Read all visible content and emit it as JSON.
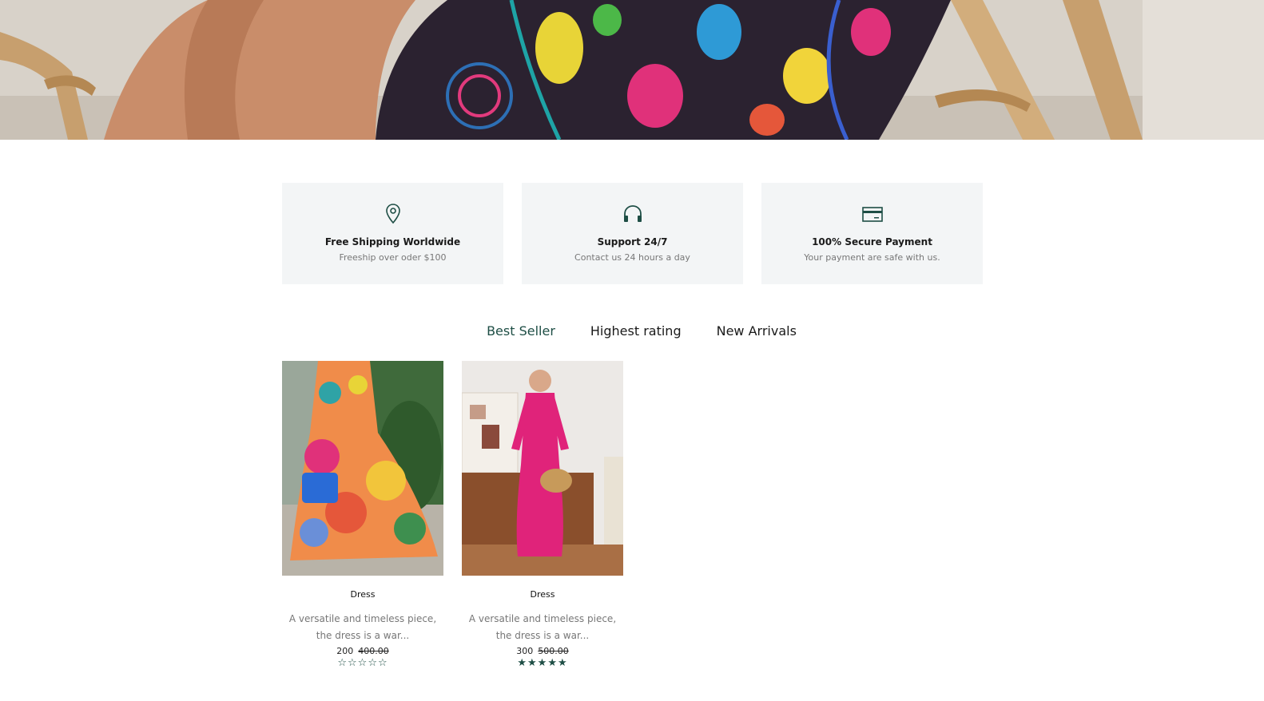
{
  "hero": {
    "image_name": "embroidered-dress-banner"
  },
  "features": [
    {
      "icon": "location-pin-icon",
      "title": "Free Shipping Worldwide",
      "subtitle": "Freeship over oder $100"
    },
    {
      "icon": "headphones-icon",
      "title": "Support 24/7",
      "subtitle": "Contact us 24 hours a day"
    },
    {
      "icon": "credit-card-icon",
      "title": "100% Secure Payment",
      "subtitle": "Your payment are safe with us."
    }
  ],
  "tabs": [
    {
      "label": "Best Seller",
      "active": true
    },
    {
      "label": "Highest rating",
      "active": false
    },
    {
      "label": "New Arrivals",
      "active": false
    }
  ],
  "products": [
    {
      "name": "Dress",
      "description": "A versatile and timeless piece, the dress is a war...",
      "price": "200",
      "old_price": "400.00",
      "rating": 0,
      "max_rating": 5
    },
    {
      "name": "Dress",
      "description": "A versatile and timeless piece, the dress is a war...",
      "price": "300",
      "old_price": "500.00",
      "rating": 5,
      "max_rating": 5
    }
  ],
  "colors": {
    "accent": "#1e4e45",
    "feature_bg": "#f3f5f6"
  }
}
